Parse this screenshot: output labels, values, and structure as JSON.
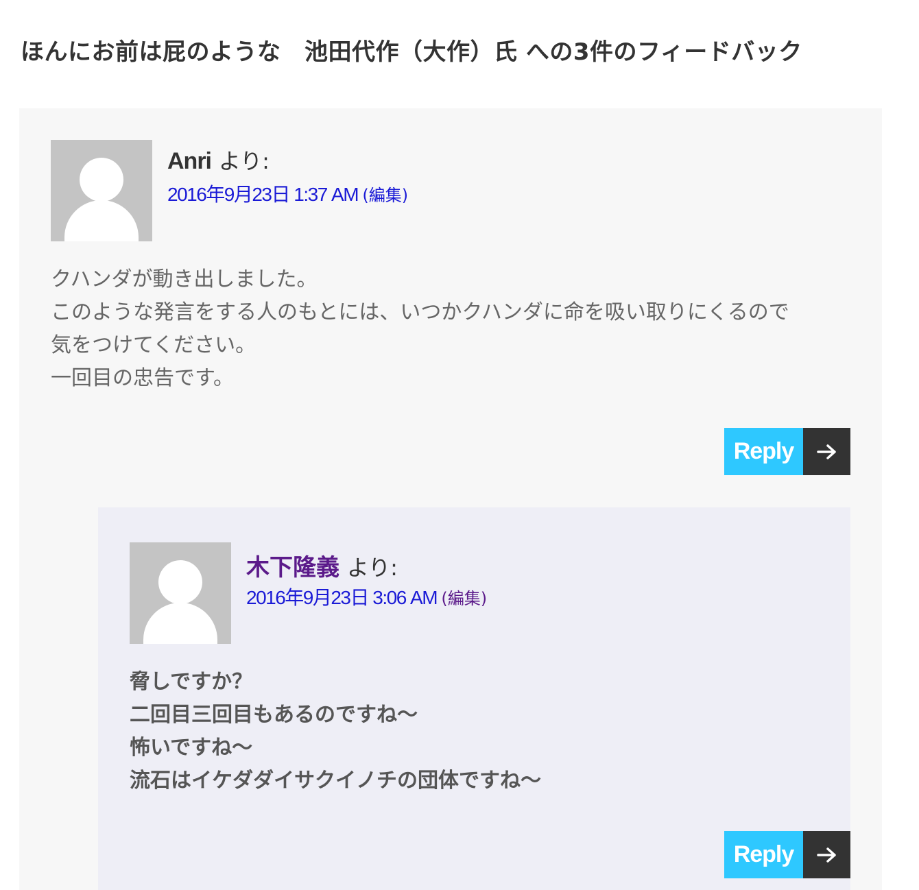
{
  "comments_title": "ほんにお前は屁のような　池田代作（大作）氏 への3件のフィードバック",
  "comments": [
    {
      "author": "Anri",
      "says": "より:",
      "date": "2016年9月23日 1:37 AM",
      "edit": "(編集)",
      "text_lines": [
        "クハンダが動き出しました。",
        "このような発言をする人のもとには、いつかクハンダに命を吸い取りにくるので",
        "気をつけてください。",
        "一回目の忠告です。"
      ],
      "reply_label": "Reply",
      "reply_icon": "arrow-right-icon"
    },
    {
      "author": "木下隆義",
      "says": "より:",
      "date": "2016年9月23日 3:06 AM",
      "edit": "(編集)",
      "text_lines": [
        "脅しですか？",
        "二回目三回目もあるのですね〜",
        "怖いですね〜",
        "流石はイケダダイサクイノチの団体ですね〜"
      ],
      "reply_label": "Reply",
      "reply_icon": "arrow-right-icon"
    }
  ],
  "colors": {
    "reply_button": "#2ec8ff",
    "reply_arrow_bg": "#333333",
    "link": "#1a1ad6",
    "visited_link": "#5b1a8a",
    "comment_bg": "#f7f7f7",
    "child_comment_bg": "#eeeef6"
  }
}
